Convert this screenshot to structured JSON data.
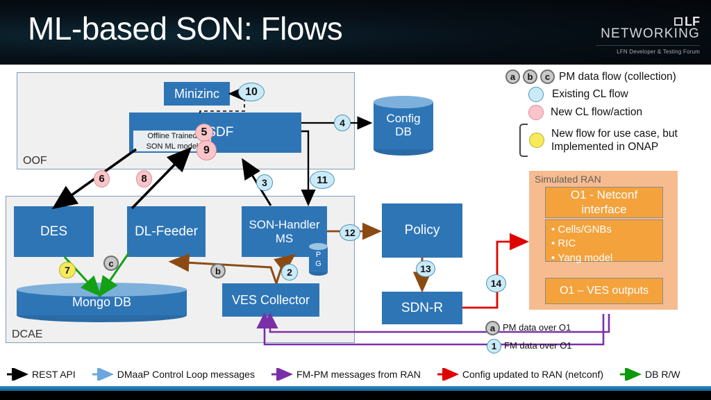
{
  "title": "ML-based SON: Flows",
  "logo": {
    "mark": "lf-square",
    "lf": "LF",
    "networking": "NETWORKING",
    "subtitle": "LFN Developer & Testing Forum"
  },
  "groups": {
    "oof": {
      "label": "OOF"
    },
    "dcae": {
      "label": "DCAE"
    },
    "ran": {
      "label": "Simulated RAN"
    }
  },
  "nodes": {
    "minizinc": "Minizinc",
    "osdf": "OSDF",
    "offline_model_line1": "Offline Trained",
    "offline_model_line2": "SON ML model",
    "config_db": "Config\nDB",
    "config_db_l1": "Config",
    "config_db_l2": "DB",
    "des": "DES",
    "dl_feeder": "DL-Feeder",
    "son_handler": "SON-Handler\nMS",
    "son_handler_l1": "SON-Handler",
    "son_handler_l2": "MS",
    "pg_l1": "P",
    "pg_l2": "G",
    "mongo_db": "Mongo DB",
    "ves_collector": "VES Collector",
    "policy": "Policy",
    "sdnr": "SDN-R"
  },
  "ran_items": {
    "netconf_l1": "O1 - Netconf",
    "netconf_l2": "interface",
    "bullets": [
      "Cells/GNBs",
      "RIC",
      "Yang model"
    ],
    "ves_outputs": "O1 – VES outputs"
  },
  "badges": [
    {
      "id": "b10",
      "label": "10",
      "type": "blue"
    },
    {
      "id": "b4",
      "label": "4",
      "type": "blue"
    },
    {
      "id": "b5",
      "label": "5",
      "type": "pink"
    },
    {
      "id": "b9",
      "label": "9",
      "type": "pink"
    },
    {
      "id": "b6",
      "label": "6",
      "type": "pink"
    },
    {
      "id": "b8",
      "label": "8",
      "type": "pink"
    },
    {
      "id": "b3",
      "label": "3",
      "type": "blue"
    },
    {
      "id": "b11",
      "label": "11",
      "type": "blue"
    },
    {
      "id": "b12",
      "label": "12",
      "type": "blue"
    },
    {
      "id": "b13",
      "label": "13",
      "type": "blue"
    },
    {
      "id": "b14",
      "label": "14",
      "type": "blue"
    },
    {
      "id": "b7",
      "label": "7",
      "type": "yellow"
    },
    {
      "id": "bc",
      "label": "c",
      "type": "gray"
    },
    {
      "id": "bb",
      "label": "b",
      "type": "gray"
    },
    {
      "id": "b2",
      "label": "2",
      "type": "blue"
    },
    {
      "id": "ba_bottom",
      "label": "a",
      "type": "gray"
    },
    {
      "id": "b1_bottom",
      "label": "1",
      "type": "blue"
    }
  ],
  "flow_labels": {
    "pm_data_over_o1": "PM data over O1",
    "fm_data_over_o1": "FM data over O1"
  },
  "legend": {
    "pm_badges": [
      "a",
      "b",
      "c"
    ],
    "pm_text": "PM data flow (collection)",
    "rows": [
      {
        "color": "#cbeaf7",
        "border": "#4a92b8",
        "text": "Existing CL flow"
      },
      {
        "color": "#fac5ca",
        "border": "#d98c93",
        "text": " New CL flow/action"
      },
      {
        "color": "#f5ea5a",
        "border": "#b9ae2c",
        "text": "New flow for use case, but\nImplemented in ONAP"
      }
    ],
    "brace_row_line1": "New flow for use case, but",
    "brace_row_line2": "Implemented in ONAP"
  },
  "bottom_legend": [
    {
      "color": "#000000",
      "text": "REST API"
    },
    {
      "color": "#6aa7dd",
      "text": "DMaaP Control Loop messages"
    },
    {
      "color": "#7a2fa8",
      "text": "FM-PM messages from RAN"
    },
    {
      "color": "#e00000",
      "text": "Config updated to RAN (netconf)"
    },
    {
      "color": "#0a9a0a",
      "text": "DB R/W"
    }
  ],
  "colors": {
    "node_blue": "#2e75b6",
    "group_fill": "#f0f0f0",
    "group_border": "#7f9bbd",
    "ran_fill": "#f6bc8f",
    "ran_box": "#f4a23c",
    "accent_black": "#000000",
    "accent_brown": "#8c4a13",
    "accent_green": "#14a014",
    "accent_red": "#e00000",
    "accent_purple": "#7a2fa8"
  }
}
